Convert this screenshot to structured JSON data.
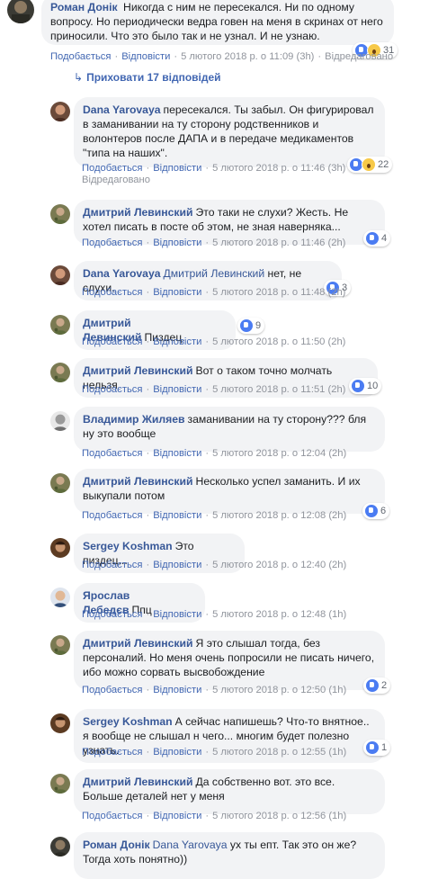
{
  "meta_labels": {
    "like": "Подобається",
    "reply": "Відповісти",
    "edited": "Відредаговано"
  },
  "hide_replies": "Приховати 17 відповідей",
  "root": {
    "author": "Роман Донік",
    "text": "Никогда с ним не пересекался. Ни по одному вопросу. Но периодически ведра говен на меня в скринах от него приносили. Что это было так и не узнал. И не узнаю.",
    "time": "5 лютого 2018 р. о 11:09 (3h)",
    "reactions": "31",
    "reply_label": "Відредаговано"
  },
  "comments": [
    {
      "author": "Dana Yarovaya",
      "text": "пересекался. Ты забыл. Он фигурировал в заманивании на ту сторону родственников и волонтеров после ДАПА и в передаче медикаментов \"типа на наших\".",
      "time": "5 лютого 2018 р. о 11:46 (3h)",
      "reactions": "22",
      "edited": true
    },
    {
      "author": "Дмитрий Левинский",
      "text": "Это таки не слухи? Жесть. Не хотел писать в посте об этом, не зная наверняка...",
      "time": "5 лютого 2018 р. о 11:46 (2h)",
      "reactions": "4"
    },
    {
      "author": "Dana Yarovaya",
      "mention": "Дмитрий Левинский",
      "text": "нет, не слухи.",
      "time": "5 лютого 2018 р. о 11:48 (2h)",
      "reactions": "3"
    },
    {
      "author": "Дмитрий Левинский",
      "text": "Пиздец.",
      "time": "5 лютого 2018 р. о 11:50 (2h)",
      "reactions": "9"
    },
    {
      "author": "Дмитрий Левинский",
      "text": "Вот о таком точно молчать нельзя",
      "time": "5 лютого 2018 р. о 11:51 (2h)",
      "reactions": "10"
    },
    {
      "author": "Владимир Жиляев",
      "text": "заманивании на ту сторону??? бля ну это вообще",
      "time": "5 лютого 2018 р. о 12:04 (2h)",
      "reactions": ""
    },
    {
      "author": "Дмитрий Левинский",
      "text": "Несколько успел заманить. И их выкупали потом",
      "time": "5 лютого 2018 р. о 12:08 (2h)",
      "reactions": "6"
    },
    {
      "author": "Sergey Koshman",
      "text": "Это пиздец...",
      "time": "5 лютого 2018 р. о 12:40 (2h)",
      "reactions": ""
    },
    {
      "author": "Ярослав Лебедєв",
      "text": "Ппц",
      "time": "5 лютого 2018 р. о 12:48 (1h)",
      "reactions": ""
    },
    {
      "author": "Дмитрий Левинский",
      "text": "Я это слышал тогда, без персоналий. Но меня очень попросили не писать ничего, ибо можно сорвать высвобождение",
      "time": "5 лютого 2018 р. о 12:50 (1h)",
      "reactions": "2"
    },
    {
      "author": "Sergey Koshman",
      "text": "А сейчас напишешь? Что-то внятное.. я вообще не слышал н чего... многим будет полезно узнать.",
      "time": "5 лютого 2018 р. о 12:55 (1h)",
      "reactions": "1"
    },
    {
      "author": "Дмитрий Левинский",
      "text": "Да собственно вот. это все. Больше деталей нет у меня",
      "time": "5 лютого 2018 р. о 12:56 (1h)",
      "reactions": ""
    },
    {
      "author": "Роман Донік",
      "mention": "Dana Yarovaya",
      "text": "ух ты епт. Так это он же? Тогда хоть понятно))",
      "time": "",
      "reactions": ""
    }
  ],
  "colors": {
    "link": "#385898",
    "bubble": "#f2f3f5",
    "meta": "#90949c",
    "like": "#4b7cf2"
  }
}
